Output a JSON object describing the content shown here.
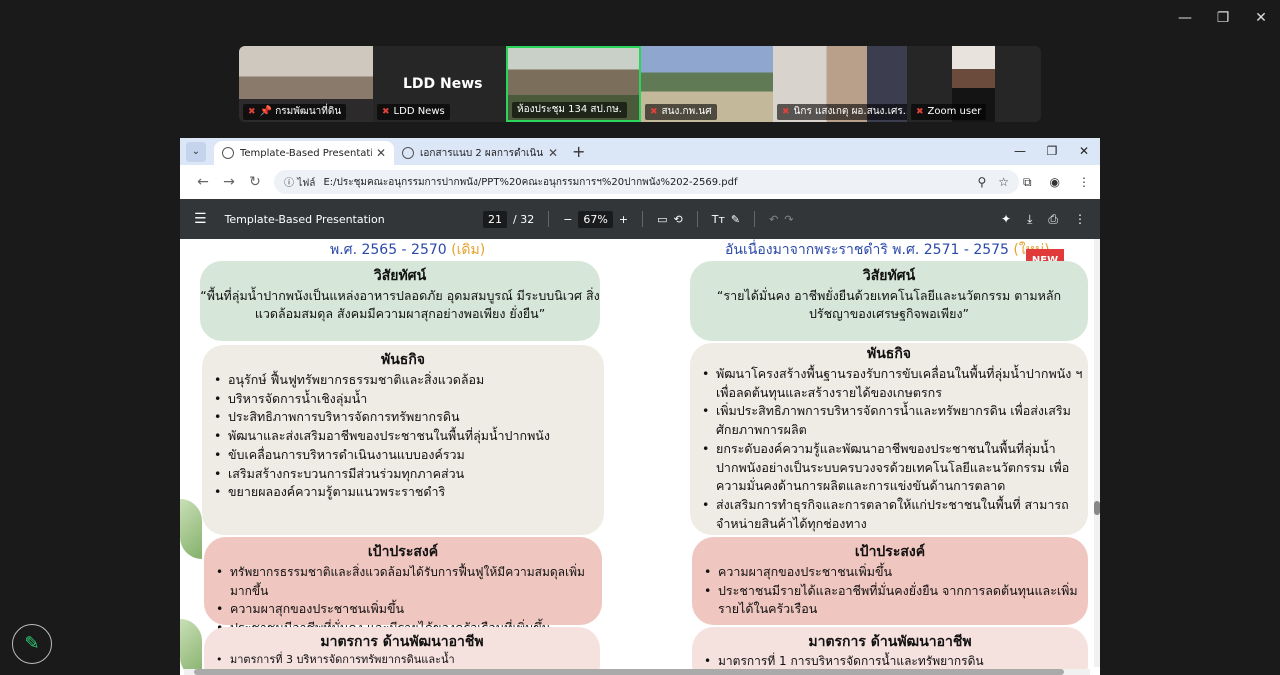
{
  "window_controls": {
    "minimize": "—",
    "maximize": "❐",
    "close": "✕"
  },
  "participants": [
    {
      "name": "กรมพัฒนาที่ดิน",
      "pinned": true
    },
    {
      "name": "LDD News",
      "big": "LDD News"
    },
    {
      "name": "ห้องประชุม 134 สป.กษ."
    },
    {
      "name": "สนง.กพ.นศ"
    },
    {
      "name": "นิกร แสงเกตุ ผอ.สนง.เศร..."
    },
    {
      "name": "Zoom user"
    }
  ],
  "browser": {
    "tabs": [
      {
        "label": "Template-Based Presentation",
        "active": true
      },
      {
        "label": "เอกสารแนบ 2 ผลการดำเนินงาน.pdf",
        "active": false
      }
    ],
    "address": {
      "info": "ไฟล์",
      "url": "E:/ประชุมคณะอนุกรรมการปากพนัง/PPT%20คณะอนุกรรมการฯ%20ปากพนัง%202-2569.pdf"
    }
  },
  "pdf": {
    "title": "Template-Based Presentation",
    "page_current": "21",
    "page_total": "/ 32",
    "zoom": "67%"
  },
  "slide": {
    "left_header": "พ.ศ. 2565 - 2570",
    "left_tag": "(เดิม)",
    "right_header": "อันเนื่องมาจากพระราชดำริ พ.ศ. 2571 - 2575",
    "right_tag": "(ใหม่)",
    "new_badge": "NEW",
    "left": {
      "vision_title": "วิสัยทัศน์",
      "vision_text": "“พื้นที่ลุ่มน้ำปากพนังเป็นแหล่งอาหารปลอดภัย อุดมสมบูรณ์ มีระบบนิเวศ สิ่งแวดล้อมสมดุล สังคมมีความผาสุกอย่างพอเพียง ยั่งยืน”",
      "mission_title": "พันธกิจ",
      "mission": [
        "อนุรักษ์ ฟื้นฟูทรัพยากรธรรมชาติและสิ่งแวดล้อม",
        "บริหารจัดการน้ำเชิงลุ่มน้ำ",
        "ประสิทธิภาพการบริหารจัดการทรัพยากรดิน",
        "พัฒนาและส่งเสริมอาชีพของประชาชนในพื้นที่ลุ่มน้ำปากพนัง",
        "ขับเคลื่อนการบริหารดำเนินงานแบบองค์รวม",
        "เสริมสร้างกระบวนการมีส่วนร่วมทุกภาคส่วน",
        "ขยายผลองค์ความรู้ตามแนวพระราชดำริ"
      ],
      "goal_title": "เป้าประสงค์",
      "goals": [
        "ทรัพยากรธรรมชาติและสิ่งแวดล้อมได้รับการฟื้นฟูให้มีความสมดุลเพิ่มมากขึ้น",
        "ความผาสุกของประชาชนเพิ่มขึ้น",
        "ประชาชนมีอาชีพที่มั่นคง และมีรายได้ของครัวเรือนที่เพิ่มขึ้น"
      ],
      "measure_title": "มาตรการ ด้านพัฒนาอาชีพ",
      "measure_item": "มาตรการที่ 3 บริหารจัดการทรัพยากรดินและน้ำ"
    },
    "right": {
      "vision_title": "วิสัยทัศน์",
      "vision_text": "“รายได้มั่นคง อาชีพยั่งยืนด้วยเทคโนโลยีและนวัตกรรม ตามหลักปรัชญาของเศรษฐกิจพอเพียง”",
      "mission_title": "พันธกิจ",
      "mission": [
        "พัฒนาโครงสร้างพื้นฐานรองรับการขับเคลื่อนในพื้นที่ลุ่มน้ำปากพนัง ฯ เพื่อลดต้นทุนและสร้างรายได้ของเกษตรกร",
        "เพิ่มประสิทธิภาพการบริหารจัดการน้ำและทรัพยากรดิน เพื่อส่งเสริมศักยภาพการผลิต",
        "ยกระดับองค์ความรู้และพัฒนาอาชีพของประชาชนในพื้นที่ลุ่มน้ำปากพนังอย่างเป็นระบบครบวงจรด้วยเทคโนโลยีและนวัตกรรม เพื่อความมั่นคงด้านการผลิตและการแข่งขันด้านการตลาด",
        "ส่งเสริมการทำธุรกิจและการตลาดให้แก่ประชาชนในพื้นที่ สามารถจำหน่ายสินค้าได้ทุกช่องทาง"
      ],
      "goal_title": "เป้าประสงค์",
      "goals": [
        "ความผาสุกของประชาชนเพิ่มขึ้น",
        "ประชาชนมีรายได้และอาชีพที่มั่นคงยั่งยืน จากการลดต้นทุนและเพิ่มรายได้ในครัวเรือน"
      ],
      "measure_title": "มาตรการ ด้านพัฒนาอาชีพ",
      "measure_item": "มาตรการที่ 1 การบริหารจัดการน้ำและทรัพยากรดิน"
    }
  }
}
